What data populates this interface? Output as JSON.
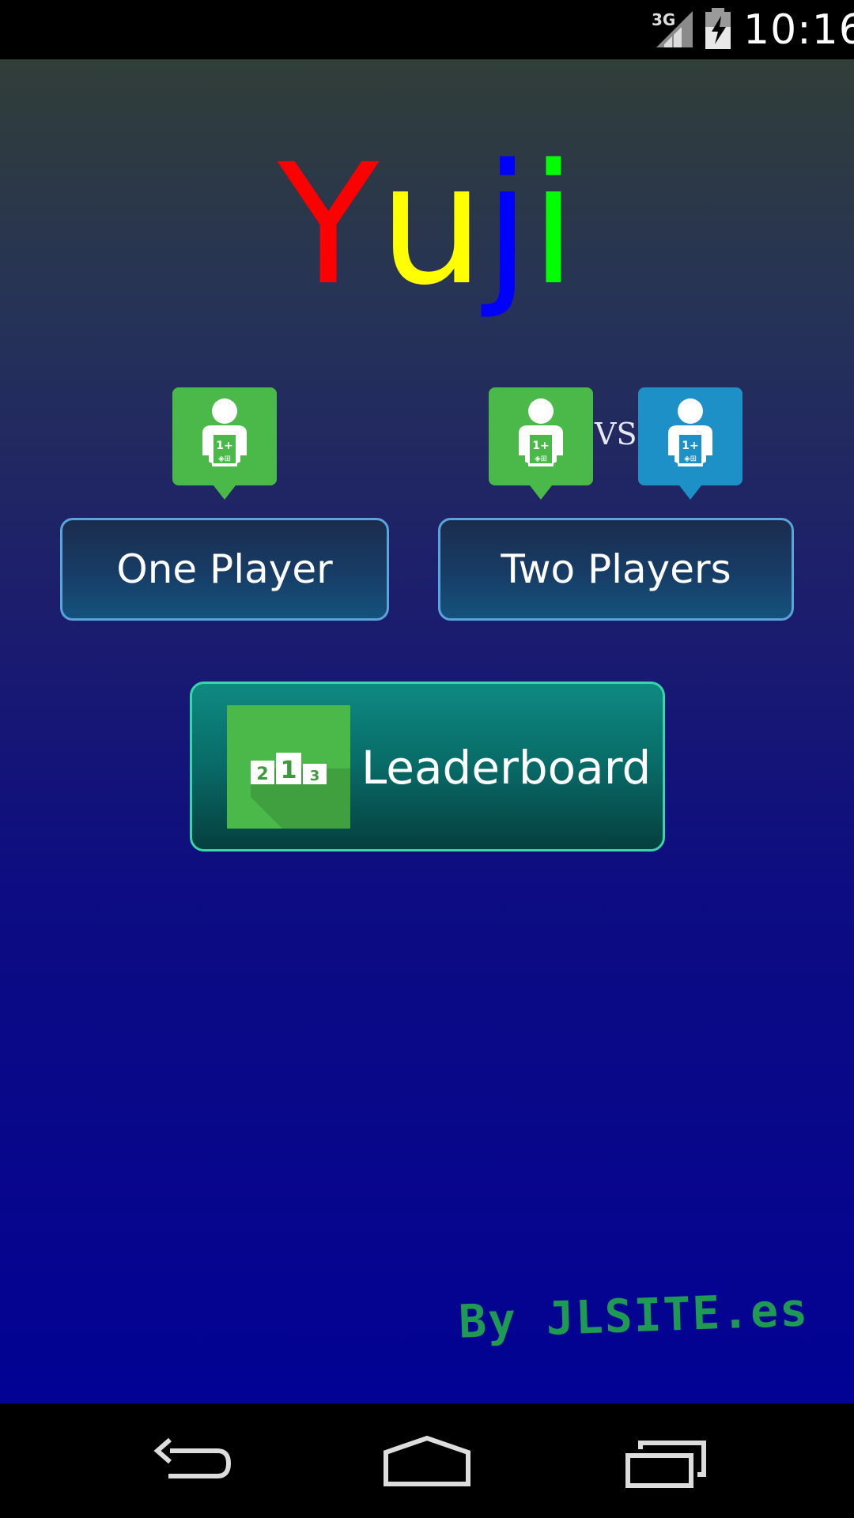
{
  "status_bar": {
    "network": "3G",
    "time": "10:16"
  },
  "app": {
    "title_letters": [
      {
        "char": "Y",
        "color": "#ff0000"
      },
      {
        "char": "u",
        "color": "#ffff00"
      },
      {
        "char": "j",
        "color": "#0000ff"
      },
      {
        "char": "i",
        "color": "#00ff00"
      }
    ],
    "vs_label": "VS",
    "one_player_label": "One Player",
    "two_players_label": "Two Players",
    "leaderboard_label": "Leaderboard",
    "podium_numbers": [
      "2",
      "1",
      "3"
    ],
    "credit": "By JLSITE.es"
  },
  "colors": {
    "pin_green": "#4bb94a",
    "pin_blue": "#1e90c8",
    "button_border": "#5aa4dc",
    "leaderboard_border": "#36d6a8"
  },
  "icons": [
    "signal-3g-icon",
    "battery-charging-icon",
    "player-pin-icon",
    "podium-icon",
    "back-icon",
    "home-icon",
    "recents-icon"
  ]
}
